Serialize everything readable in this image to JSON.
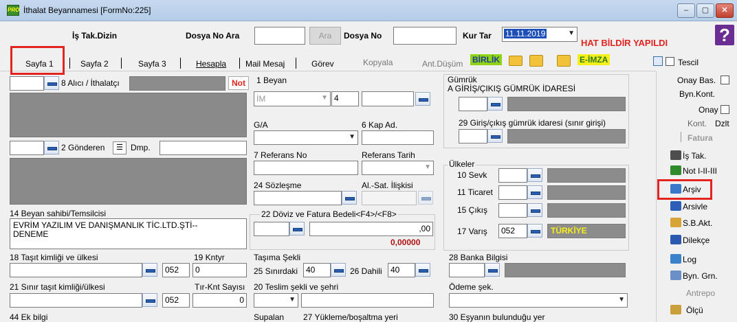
{
  "window": {
    "title": "İthalat Beyannamesi [FormNo:225]",
    "app_icon_text": "PRO",
    "min": "‒",
    "max": "▢",
    "close": "✕"
  },
  "search_bar": {
    "is_tak_dizin": "İş Tak.Dizin",
    "dosya_no_ara": "Dosya No Ara",
    "ara_button": "Ara",
    "dosya_no": "Dosya No",
    "kur_tar": "Kur Tar",
    "kur_tar_value": "11.11.2019",
    "hat_bildir": "HAT BİLDİR YAPILDI",
    "help": "?"
  },
  "tabs": {
    "sayfa1": "Sayfa 1",
    "sayfa2": "Sayfa 2",
    "sayfa3": "Sayfa 3",
    "hesapla": "Hesapla",
    "mail": "Mail Mesaj",
    "gorev": "Görev",
    "kopyala": "Kopyala",
    "ant_dusum": "Ant.Düşüm",
    "birlik": "BİRLİK",
    "eimza": "E-İMZA",
    "tescil": "Tescil"
  },
  "left": {
    "alici_label": "8 Alıcı / İthalatçı",
    "not_label": "Not",
    "gonderen_label": "2 Gönderen",
    "dmp_label": "Dmp.",
    "beyan_sahibi_label": "14 Beyan sahibi/Temsilcisi",
    "beyan_sahibi_line1": "EVRİM YAZILIM VE DANIŞMANLIK TİC.LTD.ŞTİ--",
    "beyan_sahibi_line2": "DENEME",
    "tasit_label": "18 Taşıt kimliği ve ülkesi",
    "tasit_code": "052",
    "kntyr_label": "19 Kntyr",
    "kntyr_value": "0",
    "sinir_tasit_label": "21 Sınır taşıt kimliği/ülkesi",
    "sinir_tasit_code": "052",
    "tir_label": "Tır-Knt Sayısı",
    "tir_value": "0",
    "ek_bilgi_label": "44 Ek bilgi"
  },
  "middle": {
    "beyan_label": "1 Beyan",
    "beyan_type": "İM",
    "beyan_num": "4",
    "ga_label": "G/A",
    "kap_label": "6 Kap Ad.",
    "referans_no_label": "7 Referans No",
    "referans_tarih_label": "Referans Tarih",
    "sozlesme_label": "24 Sözleşme",
    "al_sat_label": "Al.-Sat. İlişkisi",
    "doviz_label": "22 Döviz ve Fatura Bedeli<F4>/<F8>",
    "doviz_value": ",00",
    "doviz_red": "0,00000",
    "tasima_label": "Taşıma Şekli",
    "sinirdaki_label": "25 Sınırdaki",
    "sinirdaki_value": "40",
    "dahili_label": "26 Dahili",
    "dahili_value": "40",
    "supalan_label": "Supalan",
    "teslim_label": "20 Teslim şekli ve şehri",
    "yukleme_label": "27 Yükleme/boşaltma yeri"
  },
  "customs": {
    "gumruk_label": "Gümrük",
    "gumruk_sub": "A GİRİŞ/ÇIKIŞ GÜMRÜK İDARESİ",
    "giris_label": "29 Giriş/çıkış gümrük idaresi (sınır girişi)",
    "ulkeler_label": "Ülkeler",
    "sevk_label": "10 Sevk",
    "ticaret_label": "11 Ticaret",
    "cikis_label": "15 Çıkış",
    "varis_label": "17 Varış",
    "varis_code": "052",
    "varis_country": "TÜRKİYE",
    "banka_label": "28 Banka Bilgisi",
    "odeme_label": "Ödeme şek.",
    "esya_label": "30 Eşyanın bulunduğu yer"
  },
  "right_panel": {
    "onay_bas": "Onay Bas.",
    "byn_kont": "Byn.Kont.",
    "onay": "Onay",
    "kont": "Kont.",
    "dzlt": "Dzlt",
    "fatura": "Fatura",
    "is_tak": "İş Tak.",
    "not_i_ii_iii": "Not I-II-III",
    "arsiv": "Arşiv",
    "arsivle": "Arsivle",
    "sb_akt": "S.B.Akt.",
    "dilekce": "Dilekçe",
    "log": "Log",
    "byn_grn": "Byn. Grn.",
    "antrepo": "Antrepo",
    "olcu": "Ölçü"
  }
}
